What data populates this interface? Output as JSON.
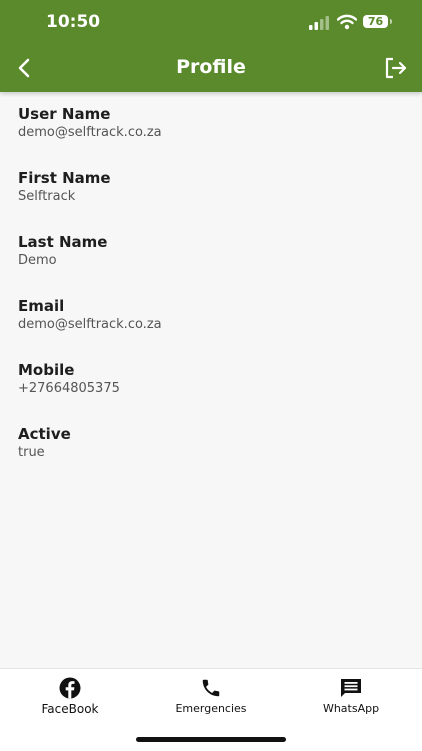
{
  "status_bar": {
    "time": "10:50",
    "battery": "76"
  },
  "header": {
    "title": "Profile",
    "back_icon": "chevron-left-icon",
    "logout_icon": "logout-icon",
    "background_color": "#5a8a2b"
  },
  "profile": {
    "fields": [
      {
        "label": "User Name",
        "value": "demo@selftrack.co.za"
      },
      {
        "label": "First Name",
        "value": "Selftrack"
      },
      {
        "label": "Last Name",
        "value": "Demo"
      },
      {
        "label": "Email",
        "value": "demo@selftrack.co.za"
      },
      {
        "label": "Mobile",
        "value": "+27664805375"
      },
      {
        "label": "Active",
        "value": "true"
      }
    ]
  },
  "bottom_nav": {
    "items": [
      {
        "label": "FaceBook",
        "icon": "facebook-icon"
      },
      {
        "label": "Emergencies",
        "icon": "phone-icon"
      },
      {
        "label": "WhatsApp",
        "icon": "message-icon"
      }
    ]
  }
}
